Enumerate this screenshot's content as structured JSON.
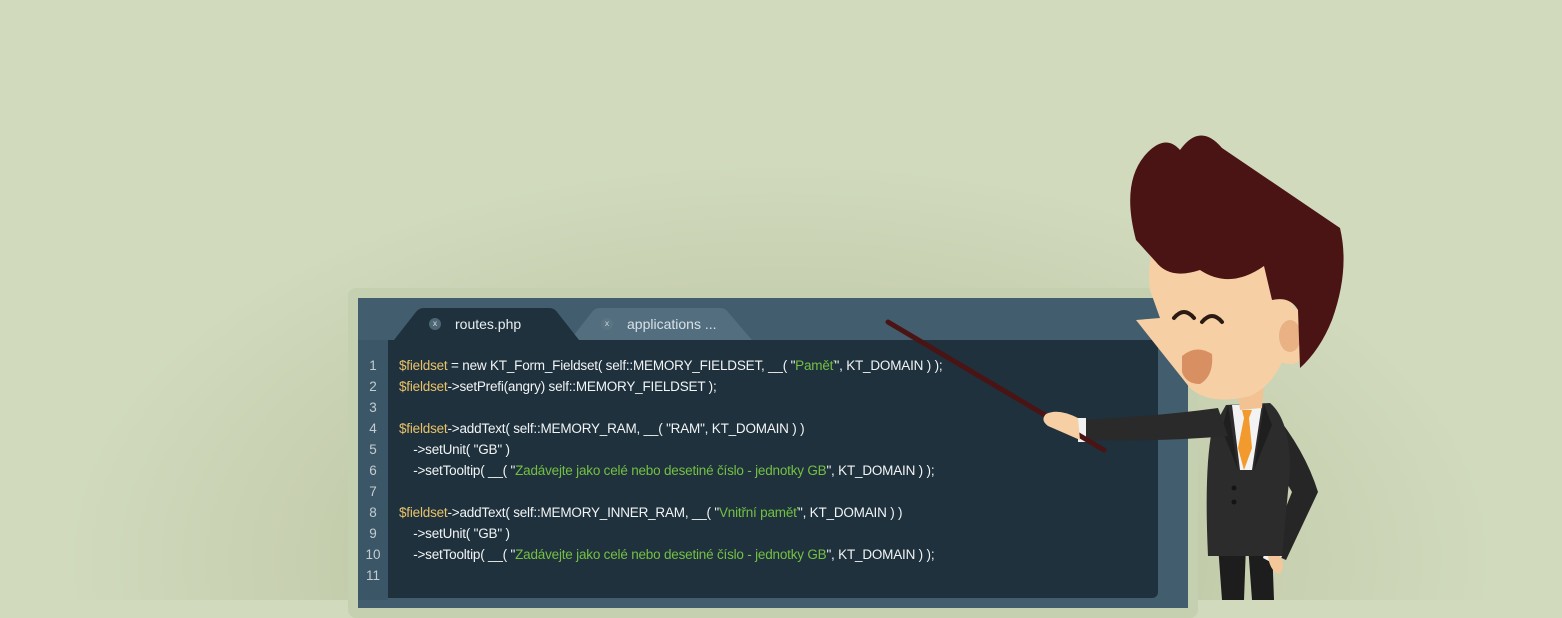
{
  "editor": {
    "tabs": [
      {
        "label": "routes.php",
        "close_glyph": "x",
        "active": true
      },
      {
        "label": "applications ...",
        "close_glyph": "x",
        "active": false
      }
    ],
    "line_numbers": [
      "1",
      "2",
      "3",
      "4",
      "5",
      "6",
      "7",
      "8",
      "9",
      "10",
      "11"
    ],
    "code": [
      {
        "var": "$fieldset",
        "pre": " = new KT_Form_Fieldset( self::MEMORY_FIELDSET, __( \"",
        "str": "Paměť",
        "post": "\", KT_DOMAIN ) );"
      },
      {
        "var": "$fieldset",
        "pre": "->setPrefi(angry) self::MEMORY_FIELDSET );",
        "str": "",
        "post": ""
      },
      {
        "var": "",
        "pre": "",
        "str": "",
        "post": ""
      },
      {
        "var": "$fieldset",
        "pre": "->addText( self::MEMORY_RAM, __( \"RAM\", KT_DOMAIN ) )",
        "str": "",
        "post": ""
      },
      {
        "var": "",
        "pre": "    ->setUnit( \"GB\" )",
        "str": "",
        "post": ""
      },
      {
        "var": "",
        "pre": "    ->setTooltip( __( \"",
        "str": "Zadávejte jako celé nebo desetiné číslo - jednotky GB",
        "post": "\", KT_DOMAIN ) );"
      },
      {
        "var": "",
        "pre": "",
        "str": "",
        "post": ""
      },
      {
        "var": "$fieldset",
        "pre": "->addText( self::MEMORY_INNER_RAM, __( \"",
        "str": "Vnitřní paměť",
        "post": "\", KT_DOMAIN ) )"
      },
      {
        "var": "",
        "pre": "    ->setUnit( \"GB\" )",
        "str": "",
        "post": ""
      },
      {
        "var": "",
        "pre": "    ->setTooltip( __( \"",
        "str": "Zadávejte jako celé nebo desetiné číslo - jednotky GB",
        "post": "\", KT_DOMAIN ) );"
      },
      {
        "var": "",
        "pre": "",
        "str": "",
        "post": ""
      }
    ]
  },
  "colors": {
    "background": "#d1dabd",
    "screen": "#425d6d",
    "code_background": "#1e313d",
    "variable": "#e9c26a",
    "string": "#74c043",
    "hair": "#4a1414",
    "suit": "#2b2b2b",
    "tie": "#f29a2e",
    "skin": "#f7cfa5"
  },
  "icons": [
    "close-icon",
    "pointer-stick",
    "teacher-character"
  ]
}
